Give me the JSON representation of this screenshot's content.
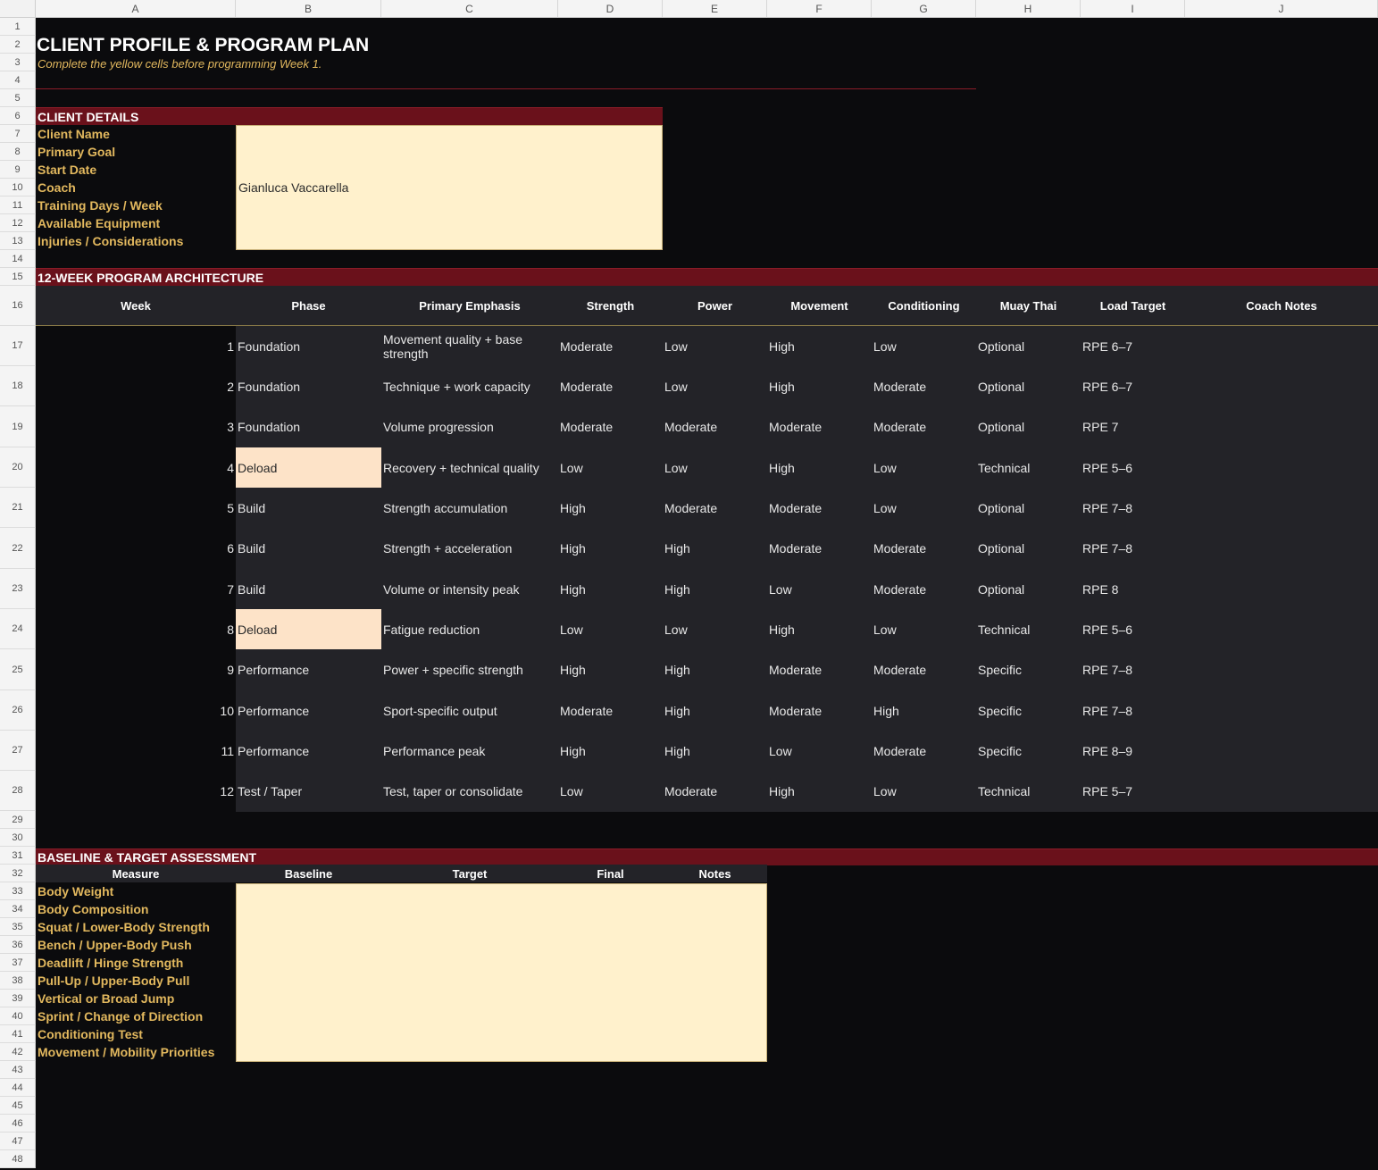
{
  "columns": [
    "A",
    "B",
    "C",
    "D",
    "E",
    "F",
    "G",
    "H",
    "I",
    "J"
  ],
  "rows": [
    "1",
    "2",
    "3",
    "4",
    "5",
    "6",
    "7",
    "8",
    "9",
    "10",
    "11",
    "12",
    "13",
    "14",
    "15",
    "16",
    "17",
    "18",
    "19",
    "20",
    "21",
    "22",
    "23",
    "24",
    "25",
    "26",
    "27",
    "28",
    "29",
    "30",
    "31",
    "32",
    "33",
    "34",
    "35",
    "36",
    "37",
    "38",
    "39",
    "40",
    "41",
    "42",
    "43",
    "44",
    "45",
    "46",
    "47",
    "48"
  ],
  "header": {
    "title": "CLIENT PROFILE & PROGRAM PLAN",
    "subtitle": "Complete the yellow cells before programming Week 1."
  },
  "client_details": {
    "section_title": "CLIENT DETAILS",
    "fields": [
      {
        "label": "Client Name",
        "value": ""
      },
      {
        "label": "Primary Goal",
        "value": ""
      },
      {
        "label": "Start Date",
        "value": ""
      },
      {
        "label": "Coach",
        "value": "Gianluca Vaccarella"
      },
      {
        "label": "Training Days / Week",
        "value": ""
      },
      {
        "label": "Available Equipment",
        "value": ""
      },
      {
        "label": "Injuries / Considerations",
        "value": ""
      }
    ]
  },
  "program": {
    "section_title": "12-WEEK PROGRAM ARCHITECTURE",
    "headers": [
      "Week",
      "Phase",
      "Primary Emphasis",
      "Strength",
      "Power",
      "Movement",
      "Conditioning",
      "Muay Thai",
      "Load Target",
      "Coach Notes"
    ],
    "weeks": [
      {
        "week": "1",
        "phase": "Foundation",
        "emphasis": "Movement quality + base strength",
        "strength": "Moderate",
        "power": "Low",
        "movement": "High",
        "conditioning": "Low",
        "muay_thai": "Optional",
        "load": "RPE 6–7",
        "notes": ""
      },
      {
        "week": "2",
        "phase": "Foundation",
        "emphasis": "Technique + work capacity",
        "strength": "Moderate",
        "power": "Low",
        "movement": "High",
        "conditioning": "Moderate",
        "muay_thai": "Optional",
        "load": "RPE 6–7",
        "notes": ""
      },
      {
        "week": "3",
        "phase": "Foundation",
        "emphasis": "Volume progression",
        "strength": "Moderate",
        "power": "Moderate",
        "movement": "Moderate",
        "conditioning": "Moderate",
        "muay_thai": "Optional",
        "load": "RPE 7",
        "notes": ""
      },
      {
        "week": "4",
        "phase": "Deload",
        "emphasis": "Recovery + technical quality",
        "strength": "Low",
        "power": "Low",
        "movement": "High",
        "conditioning": "Low",
        "muay_thai": "Technical",
        "load": "RPE 5–6",
        "notes": ""
      },
      {
        "week": "5",
        "phase": "Build",
        "emphasis": "Strength accumulation",
        "strength": "High",
        "power": "Moderate",
        "movement": "Moderate",
        "conditioning": "Low",
        "muay_thai": "Optional",
        "load": "RPE 7–8",
        "notes": ""
      },
      {
        "week": "6",
        "phase": "Build",
        "emphasis": "Strength + acceleration",
        "strength": "High",
        "power": "High",
        "movement": "Moderate",
        "conditioning": "Moderate",
        "muay_thai": "Optional",
        "load": "RPE 7–8",
        "notes": ""
      },
      {
        "week": "7",
        "phase": "Build",
        "emphasis": "Volume or intensity peak",
        "strength": "High",
        "power": "High",
        "movement": "Low",
        "conditioning": "Moderate",
        "muay_thai": "Optional",
        "load": "RPE 8",
        "notes": ""
      },
      {
        "week": "8",
        "phase": "Deload",
        "emphasis": "Fatigue reduction",
        "strength": "Low",
        "power": "Low",
        "movement": "High",
        "conditioning": "Low",
        "muay_thai": "Technical",
        "load": "RPE 5–6",
        "notes": ""
      },
      {
        "week": "9",
        "phase": "Performance",
        "emphasis": "Power + specific strength",
        "strength": "High",
        "power": "High",
        "movement": "Moderate",
        "conditioning": "Moderate",
        "muay_thai": "Specific",
        "load": "RPE 7–8",
        "notes": ""
      },
      {
        "week": "10",
        "phase": "Performance",
        "emphasis": "Sport-specific output",
        "strength": "Moderate",
        "power": "High",
        "movement": "Moderate",
        "conditioning": "High",
        "muay_thai": "Specific",
        "load": "RPE 7–8",
        "notes": ""
      },
      {
        "week": "11",
        "phase": "Performance",
        "emphasis": "Performance peak",
        "strength": "High",
        "power": "High",
        "movement": "Low",
        "conditioning": "Moderate",
        "muay_thai": "Specific",
        "load": "RPE 8–9",
        "notes": ""
      },
      {
        "week": "12",
        "phase": "Test / Taper",
        "emphasis": "Test, taper or consolidate",
        "strength": "Low",
        "power": "Moderate",
        "movement": "High",
        "conditioning": "Low",
        "muay_thai": "Technical",
        "load": "RPE 5–7",
        "notes": ""
      }
    ]
  },
  "assessment": {
    "section_title": "BASELINE & TARGET ASSESSMENT",
    "headers": [
      "Measure",
      "Baseline",
      "Target",
      "Final",
      "Notes"
    ],
    "measures": [
      "Body Weight",
      "Body Composition",
      "Squat / Lower-Body Strength",
      "Bench / Upper-Body Push",
      "Deadlift / Hinge Strength",
      "Pull-Up / Upper-Body Pull",
      "Vertical or Broad Jump",
      "Sprint / Change of Direction",
      "Conditioning Test",
      "Movement / Mobility Priorities"
    ]
  },
  "colors": {
    "section_bar": "#6a111b",
    "label_gold": "#e2b85e",
    "input_yellow": "#fff1cc",
    "deload_peach": "#fde3c8",
    "table_bg": "#232328",
    "sheet_bg": "#0b0b0d"
  }
}
